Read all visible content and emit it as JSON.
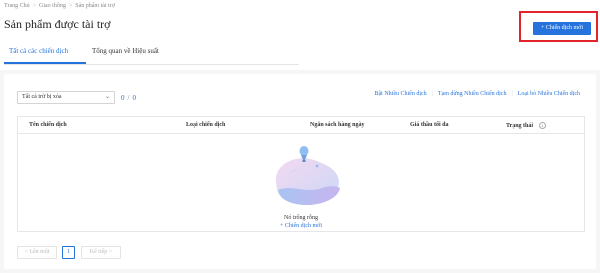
{
  "breadcrumb": {
    "items": [
      "Trang Chủ",
      "Giao thông",
      "Sản phẩm tài trợ"
    ],
    "separator": ">"
  },
  "page": {
    "title": "Sản phẩm được tài trợ"
  },
  "header": {
    "create_button": "+ Chiến dịch mới"
  },
  "tabs": [
    {
      "label": "Tất cả các chiến dịch",
      "active": true
    },
    {
      "label": "Tổng quan về Hiệu suất",
      "active": false
    }
  ],
  "filter": {
    "selected": "Tất cả trừ bị xóa",
    "selected_count": "0",
    "total_count": "0"
  },
  "bulk_actions": [
    "Bật Nhiều Chiến dịch",
    "Tạm dừng Nhiều Chiến dịch",
    "Loại bỏ Nhiều Chiến dịch"
  ],
  "table": {
    "columns": [
      "Tên chiến dịch",
      "Loại chiến dịch",
      "Ngân sách hàng ngày",
      "Giá thầu tối đa",
      "Trạng thái"
    ],
    "empty_text": "Nó trống rỗng",
    "empty_link": "+ Chiến dịch mới"
  },
  "pagination": {
    "prev": "< Lên một",
    "page": "1",
    "next": "Kế tiếp >"
  },
  "colors": {
    "accent": "#2673dd",
    "highlight": "#e3242b"
  }
}
